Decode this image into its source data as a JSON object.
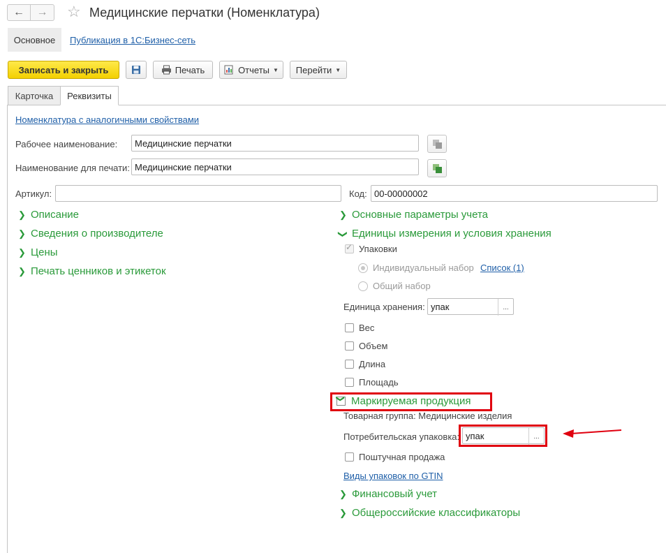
{
  "window": {
    "title": "Медицинские перчатки (Номенклатура)"
  },
  "top_tabs": {
    "main": "Основное",
    "publish_link": "Публикация в 1С:Бизнес-сеть"
  },
  "toolbar": {
    "save_close": "Записать и закрыть",
    "print": "Печать",
    "reports": "Отчеты",
    "goto": "Перейти"
  },
  "form_tabs": [
    "Карточка",
    "Реквизиты"
  ],
  "form": {
    "similar_link": "Номенклатура с аналогичными свойствами",
    "work_name_label": "Рабочее наименование:",
    "work_name_value": "Медицинские перчатки",
    "print_name_label": "Наименование для печати:",
    "print_name_value": "Медицинские перчатки",
    "article_label": "Артикул:",
    "article_value": "",
    "code_label": "Код:",
    "code_value": "00-00000002"
  },
  "left_groups": [
    "Описание",
    "Сведения о производителе",
    "Цены",
    "Печать ценников и этикеток"
  ],
  "right": {
    "basic_params": "Основные параметры учета",
    "units_storage": "Единицы измерения и условия хранения",
    "packages_label": "Упаковки",
    "individual_set": "Индивидуальный набор",
    "list_link": "Список (1)",
    "common_set": "Общий набор",
    "storage_unit_label": "Единица хранения:",
    "storage_unit_value": "упак",
    "weight": "Вес",
    "volume": "Объем",
    "length": "Длина",
    "area": "Площадь",
    "marked_products": "Маркируемая продукция",
    "product_group": "Товарная группа: Медицинские изделия",
    "consumer_pack_label": "Потребительская упаковка:",
    "consumer_pack_value": "упак",
    "piece_sale": "Поштучная продажа",
    "gtin_link": "Виды упаковок по GTIN",
    "financial": "Финансовый учет",
    "classifiers": "Общероссийские классификаторы"
  },
  "icons": {
    "back": "arrow-left-icon",
    "forward": "arrow-right-icon",
    "favorite": "star-icon",
    "save": "floppy-disk-icon",
    "print": "printer-icon",
    "reports": "report-icon",
    "copy": "copy-icon"
  },
  "colors": {
    "accent_green": "#2a9a3a",
    "link_blue": "#1f5fa8",
    "primary_yellow": "#f3d000",
    "annotation_red": "#e0000f"
  }
}
